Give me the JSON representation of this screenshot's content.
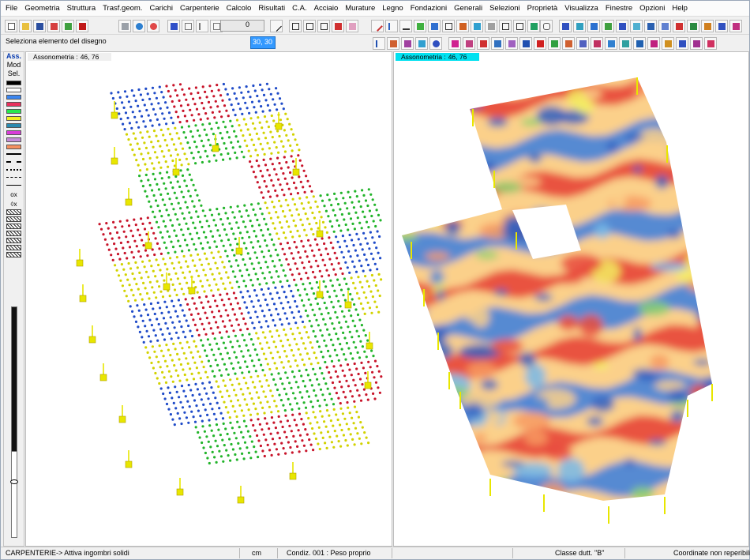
{
  "menu": [
    "File",
    "Geometria",
    "Struttura",
    "Trasf.geom.",
    "Carichi",
    "Carpenterie",
    "Calcolo",
    "Risultati",
    "C.A.",
    "Acciaio",
    "Murature",
    "Legno",
    "Fondazioni",
    "Generali",
    "Selezioni",
    "Proprietà",
    "Visualizza",
    "Finestre",
    "Opzioni",
    "Help"
  ],
  "toolbar": {
    "prompt": "Seleziona  elemento del disegno",
    "number_value": "0",
    "coord_value": "30, 30"
  },
  "palette": {
    "modes": [
      "Ass.",
      "Mod",
      "Sel."
    ],
    "colors": [
      "#000000",
      "#ffffff",
      "#3b86f0",
      "#e8305c",
      "#27e850",
      "#f0f022",
      "#2a8ab0",
      "#d83cd8",
      "#c48cd8",
      "#f49060"
    ],
    "glyphs": [
      "o",
      "x",
      "◊",
      "x"
    ]
  },
  "viewport_left": {
    "label": "Assonometria :",
    "value": "46, 76",
    "zone_colors": {
      "blue": "#1f4bc8",
      "red": "#c8142a",
      "yellow": "#d2d200",
      "green": "#22b42a"
    },
    "support_color": "#e8e600"
  },
  "viewport_right": {
    "label": "Assonometria :",
    "value": "46, 76",
    "contour_palette": [
      "#e84b3c",
      "#f79a60",
      "#fbd08a",
      "#f3ee62",
      "#8bd06d",
      "#77b8e8",
      "#4d86d6",
      "#2f5fc0"
    ]
  },
  "statusbar": {
    "mode": "CARPENTERIE-> Attiva ingombri solidi",
    "units": "cm",
    "condition": "Condiz. 001 : Peso proprio",
    "ductility": "Classe dutt. \"B\"",
    "coords": "Coordinate non reperibili"
  }
}
